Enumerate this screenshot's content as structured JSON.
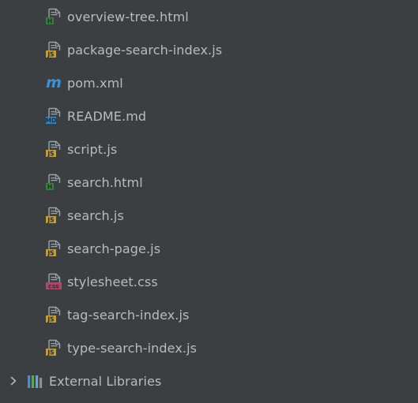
{
  "project_tree": {
    "files": [
      {
        "label": "overview-tree.html",
        "icon": "html-file-icon",
        "badge": "H",
        "badge_color": "#3d7a3d"
      },
      {
        "label": "package-search-index.js",
        "icon": "js-file-icon",
        "badge": "JS",
        "badge_color": "#c19a45"
      },
      {
        "label": "pom.xml",
        "icon": "maven-icon",
        "glyph": "m",
        "glyph_color": "#3f8fd6"
      },
      {
        "label": "README.md",
        "icon": "markdown-file-icon",
        "badge": "MD",
        "badge_color": "#3b87c4"
      },
      {
        "label": "script.js",
        "icon": "js-file-icon",
        "badge": "JS",
        "badge_color": "#c19a45"
      },
      {
        "label": "search.html",
        "icon": "html-file-icon",
        "badge": "H",
        "badge_color": "#3d7a3d"
      },
      {
        "label": "search.js",
        "icon": "js-file-icon",
        "badge": "JS",
        "badge_color": "#c19a45"
      },
      {
        "label": "search-page.js",
        "icon": "js-file-icon",
        "badge": "JS",
        "badge_color": "#c19a45"
      },
      {
        "label": "stylesheet.css",
        "icon": "css-file-icon",
        "badge": "CSS",
        "badge_color": "#a24e6a"
      },
      {
        "label": "tag-search-index.js",
        "icon": "js-file-icon",
        "badge": "JS",
        "badge_color": "#c19a45"
      },
      {
        "label": "type-search-index.js",
        "icon": "js-file-icon",
        "badge": "JS",
        "badge_color": "#c19a45"
      }
    ],
    "external_libraries": {
      "label": "External Libraries",
      "icon": "library-bars-icon",
      "expander": "chevron-right-icon",
      "bar_colors": [
        "#3f8fd6",
        "#5fa35f",
        "#6aa3d6",
        "#8f8f8f"
      ]
    }
  }
}
